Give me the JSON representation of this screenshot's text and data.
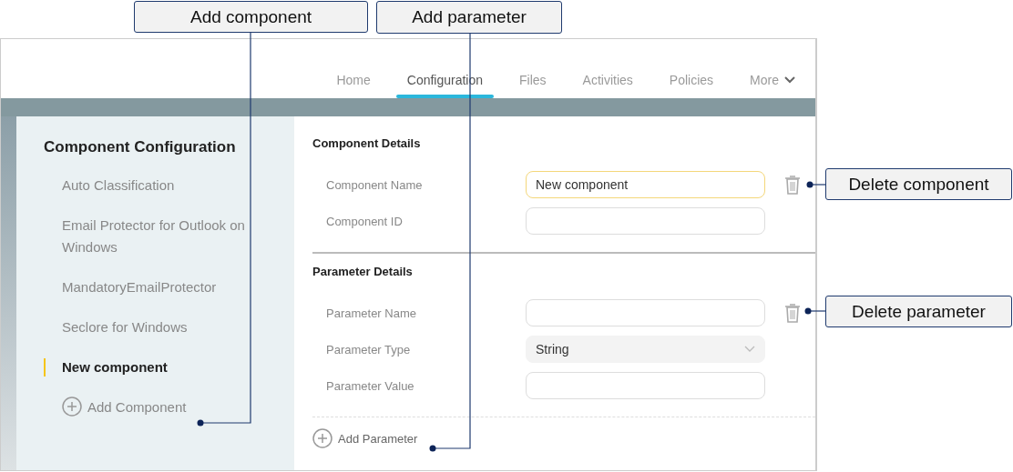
{
  "nav": {
    "tabs": [
      {
        "label": "Home",
        "selected": false
      },
      {
        "label": "Configuration",
        "selected": true
      },
      {
        "label": "Files",
        "selected": false
      },
      {
        "label": "Activities",
        "selected": false
      },
      {
        "label": "Policies",
        "selected": false
      },
      {
        "label": "More",
        "selected": false,
        "kind": "menu"
      }
    ]
  },
  "sidebar": {
    "title": "Component Configuration",
    "items": [
      {
        "label": "Auto Classification",
        "selected": false
      },
      {
        "label": "Email Protector for Outlook on Windows",
        "selected": false
      },
      {
        "label": "MandatoryEmailProtector",
        "selected": false
      },
      {
        "label": "Seclore for Windows",
        "selected": false
      },
      {
        "label": "New component",
        "selected": true
      }
    ],
    "add_button": "Add Component"
  },
  "sections": [
    {
      "title": "Component Details",
      "fields": [
        {
          "label": "Component Name",
          "kind": "text",
          "value": "New component",
          "focused": true,
          "deletable": true
        },
        {
          "label": "Component ID",
          "kind": "text",
          "focused": false,
          "deletable": false
        }
      ]
    },
    {
      "title": "Parameter Details",
      "fields": [
        {
          "label": "Parameter Name",
          "kind": "text",
          "focused": false,
          "deletable": true
        },
        {
          "label": "Parameter Type",
          "kind": "select",
          "value": "String",
          "focused": false,
          "deletable": false
        },
        {
          "label": "Parameter Value",
          "kind": "text",
          "focused": false,
          "deletable": false
        }
      ]
    }
  ],
  "add_parameter": "Add Parameter",
  "callouts": [
    {
      "text": "Add component"
    },
    {
      "text": "Add parameter"
    },
    {
      "text": "Delete component"
    },
    {
      "text": "Delete parameter"
    }
  ]
}
